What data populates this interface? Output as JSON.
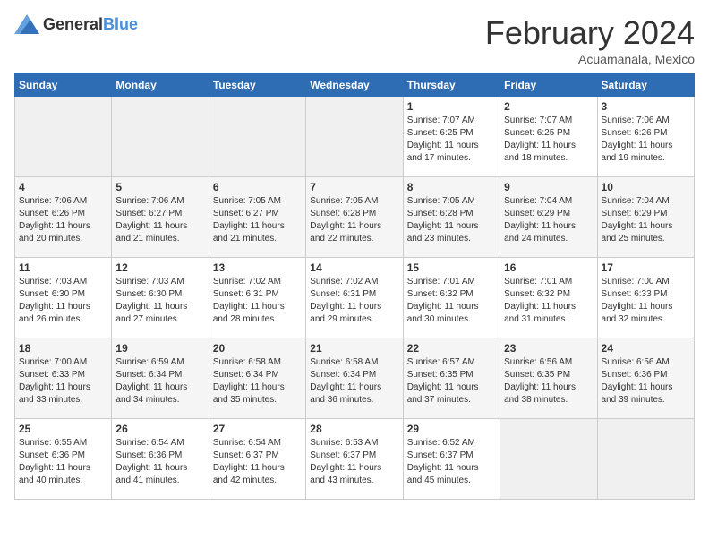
{
  "header": {
    "logo_general": "General",
    "logo_blue": "Blue",
    "title": "February 2024",
    "location": "Acuamanala, Mexico"
  },
  "days_of_week": [
    "Sunday",
    "Monday",
    "Tuesday",
    "Wednesday",
    "Thursday",
    "Friday",
    "Saturday"
  ],
  "weeks": [
    [
      {
        "num": "",
        "info": "",
        "empty": true
      },
      {
        "num": "",
        "info": "",
        "empty": true
      },
      {
        "num": "",
        "info": "",
        "empty": true
      },
      {
        "num": "",
        "info": "",
        "empty": true
      },
      {
        "num": "1",
        "info": "Sunrise: 7:07 AM\nSunset: 6:25 PM\nDaylight: 11 hours\nand 17 minutes."
      },
      {
        "num": "2",
        "info": "Sunrise: 7:07 AM\nSunset: 6:25 PM\nDaylight: 11 hours\nand 18 minutes."
      },
      {
        "num": "3",
        "info": "Sunrise: 7:06 AM\nSunset: 6:26 PM\nDaylight: 11 hours\nand 19 minutes."
      }
    ],
    [
      {
        "num": "4",
        "info": "Sunrise: 7:06 AM\nSunset: 6:26 PM\nDaylight: 11 hours\nand 20 minutes."
      },
      {
        "num": "5",
        "info": "Sunrise: 7:06 AM\nSunset: 6:27 PM\nDaylight: 11 hours\nand 21 minutes."
      },
      {
        "num": "6",
        "info": "Sunrise: 7:05 AM\nSunset: 6:27 PM\nDaylight: 11 hours\nand 21 minutes."
      },
      {
        "num": "7",
        "info": "Sunrise: 7:05 AM\nSunset: 6:28 PM\nDaylight: 11 hours\nand 22 minutes."
      },
      {
        "num": "8",
        "info": "Sunrise: 7:05 AM\nSunset: 6:28 PM\nDaylight: 11 hours\nand 23 minutes."
      },
      {
        "num": "9",
        "info": "Sunrise: 7:04 AM\nSunset: 6:29 PM\nDaylight: 11 hours\nand 24 minutes."
      },
      {
        "num": "10",
        "info": "Sunrise: 7:04 AM\nSunset: 6:29 PM\nDaylight: 11 hours\nand 25 minutes."
      }
    ],
    [
      {
        "num": "11",
        "info": "Sunrise: 7:03 AM\nSunset: 6:30 PM\nDaylight: 11 hours\nand 26 minutes."
      },
      {
        "num": "12",
        "info": "Sunrise: 7:03 AM\nSunset: 6:30 PM\nDaylight: 11 hours\nand 27 minutes."
      },
      {
        "num": "13",
        "info": "Sunrise: 7:02 AM\nSunset: 6:31 PM\nDaylight: 11 hours\nand 28 minutes."
      },
      {
        "num": "14",
        "info": "Sunrise: 7:02 AM\nSunset: 6:31 PM\nDaylight: 11 hours\nand 29 minutes."
      },
      {
        "num": "15",
        "info": "Sunrise: 7:01 AM\nSunset: 6:32 PM\nDaylight: 11 hours\nand 30 minutes."
      },
      {
        "num": "16",
        "info": "Sunrise: 7:01 AM\nSunset: 6:32 PM\nDaylight: 11 hours\nand 31 minutes."
      },
      {
        "num": "17",
        "info": "Sunrise: 7:00 AM\nSunset: 6:33 PM\nDaylight: 11 hours\nand 32 minutes."
      }
    ],
    [
      {
        "num": "18",
        "info": "Sunrise: 7:00 AM\nSunset: 6:33 PM\nDaylight: 11 hours\nand 33 minutes."
      },
      {
        "num": "19",
        "info": "Sunrise: 6:59 AM\nSunset: 6:34 PM\nDaylight: 11 hours\nand 34 minutes."
      },
      {
        "num": "20",
        "info": "Sunrise: 6:58 AM\nSunset: 6:34 PM\nDaylight: 11 hours\nand 35 minutes."
      },
      {
        "num": "21",
        "info": "Sunrise: 6:58 AM\nSunset: 6:34 PM\nDaylight: 11 hours\nand 36 minutes."
      },
      {
        "num": "22",
        "info": "Sunrise: 6:57 AM\nSunset: 6:35 PM\nDaylight: 11 hours\nand 37 minutes."
      },
      {
        "num": "23",
        "info": "Sunrise: 6:56 AM\nSunset: 6:35 PM\nDaylight: 11 hours\nand 38 minutes."
      },
      {
        "num": "24",
        "info": "Sunrise: 6:56 AM\nSunset: 6:36 PM\nDaylight: 11 hours\nand 39 minutes."
      }
    ],
    [
      {
        "num": "25",
        "info": "Sunrise: 6:55 AM\nSunset: 6:36 PM\nDaylight: 11 hours\nand 40 minutes."
      },
      {
        "num": "26",
        "info": "Sunrise: 6:54 AM\nSunset: 6:36 PM\nDaylight: 11 hours\nand 41 minutes."
      },
      {
        "num": "27",
        "info": "Sunrise: 6:54 AM\nSunset: 6:37 PM\nDaylight: 11 hours\nand 42 minutes."
      },
      {
        "num": "28",
        "info": "Sunrise: 6:53 AM\nSunset: 6:37 PM\nDaylight: 11 hours\nand 43 minutes."
      },
      {
        "num": "29",
        "info": "Sunrise: 6:52 AM\nSunset: 6:37 PM\nDaylight: 11 hours\nand 45 minutes."
      },
      {
        "num": "",
        "info": "",
        "empty": true
      },
      {
        "num": "",
        "info": "",
        "empty": true
      }
    ]
  ]
}
